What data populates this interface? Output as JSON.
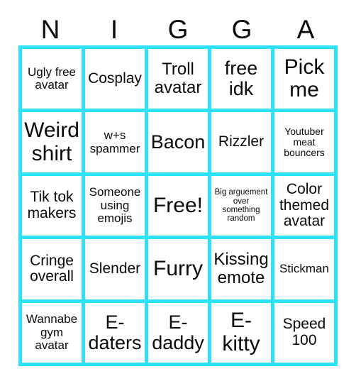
{
  "card": {
    "title_letters": [
      "N",
      "I",
      "G",
      "G",
      "A"
    ],
    "border_color": "#2FE1F5",
    "cell_background": "#FFFFFF",
    "text_color": "#0A0A0A",
    "columns": 5,
    "rows": 5,
    "free_space_index": 12,
    "cells": [
      {
        "text": "Ugly free avatar",
        "size": "sm"
      },
      {
        "text": "Cosplay",
        "size": "md"
      },
      {
        "text": "Troll avatar",
        "size": "lg"
      },
      {
        "text": "free idk",
        "size": "xl"
      },
      {
        "text": "Pick me",
        "size": "xxl"
      },
      {
        "text": "Weird shirt",
        "size": "xxl"
      },
      {
        "text": "w+s spammer",
        "size": "sm"
      },
      {
        "text": "Bacon",
        "size": "xl"
      },
      {
        "text": "Rizzler",
        "size": "md"
      },
      {
        "text": "Youtuber meat bouncers",
        "size": "xs"
      },
      {
        "text": "Tik tok makers",
        "size": "md"
      },
      {
        "text": "Someone using emojis",
        "size": "sm"
      },
      {
        "text": "Free!",
        "size": "xxl"
      },
      {
        "text": "Big arguement over something random",
        "size": "xxs"
      },
      {
        "text": "Color themed avatar",
        "size": "md"
      },
      {
        "text": "Cringe overall",
        "size": "md"
      },
      {
        "text": "Slender",
        "size": "md"
      },
      {
        "text": "Furry",
        "size": "xxl"
      },
      {
        "text": "Kissing emote",
        "size": "lg"
      },
      {
        "text": "Stickman",
        "size": "sm"
      },
      {
        "text": "Wannabe gym avatar",
        "size": "sm"
      },
      {
        "text": "E-daters",
        "size": "xl"
      },
      {
        "text": "E-daddy",
        "size": "xl"
      },
      {
        "text": "E-kitty",
        "size": "xxl"
      },
      {
        "text": "Speed 100",
        "size": "md"
      }
    ]
  }
}
